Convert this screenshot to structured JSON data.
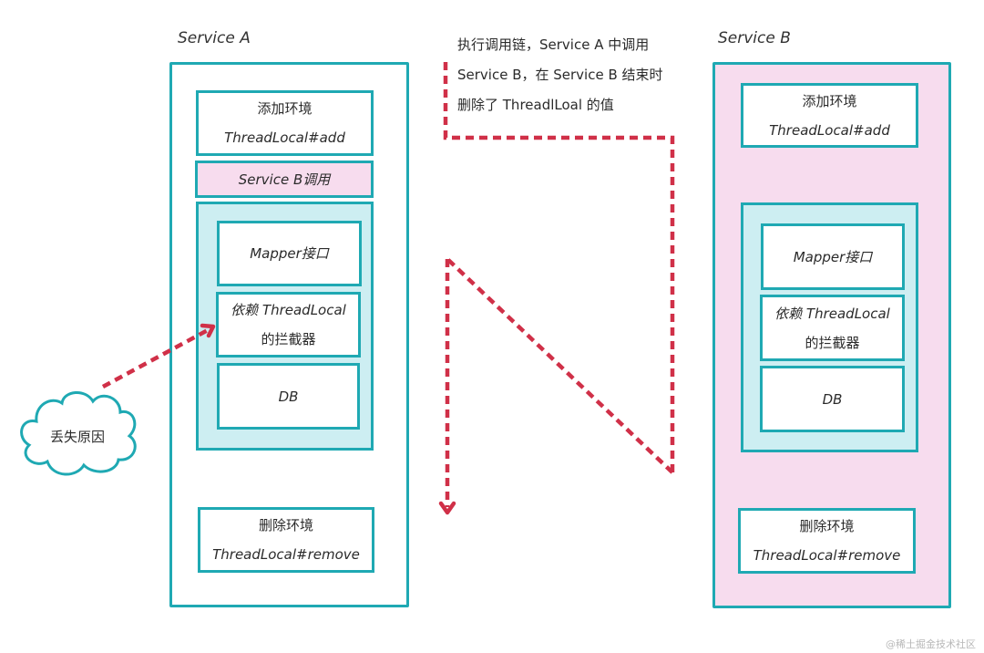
{
  "diagram": {
    "service_a": {
      "title": "Service A",
      "add_box": {
        "line1": "添加环境",
        "line2": "ThreadLocal#add"
      },
      "call_box": {
        "label": "Service B调用"
      },
      "mapper_box": {
        "label": "Mapper接口"
      },
      "interceptor_box": {
        "line1": "依赖 ThreadLocal",
        "line2": "的拦截器"
      },
      "db_box": {
        "label": "DB"
      },
      "remove_box": {
        "line1": "删除环境",
        "line2": "ThreadLocal#remove"
      }
    },
    "service_b": {
      "title": "Service B",
      "add_box": {
        "line1": "添加环境",
        "line2": "ThreadLocal#add"
      },
      "mapper_box": {
        "label": "Mapper接口"
      },
      "interceptor_box": {
        "line1": "依赖 ThreadLocal",
        "line2": "的拦截器"
      },
      "db_box": {
        "label": "DB"
      },
      "remove_box": {
        "line1": "删除环境",
        "line2": "ThreadLocal#remove"
      }
    },
    "note": {
      "line1": "执行调用链，Service A 中调用",
      "line2": "Service B，在 Service B 结束时",
      "line3": "删除了 ThreadlLoal 的值"
    },
    "cloud": {
      "label": "丢失原因"
    },
    "watermark": "@稀土掘金技术社区",
    "colors": {
      "border": "#1fa9b3",
      "pink_fill": "#f7dcee",
      "cyan_fill": "#cdeef2",
      "arrow": "#d03048"
    }
  }
}
